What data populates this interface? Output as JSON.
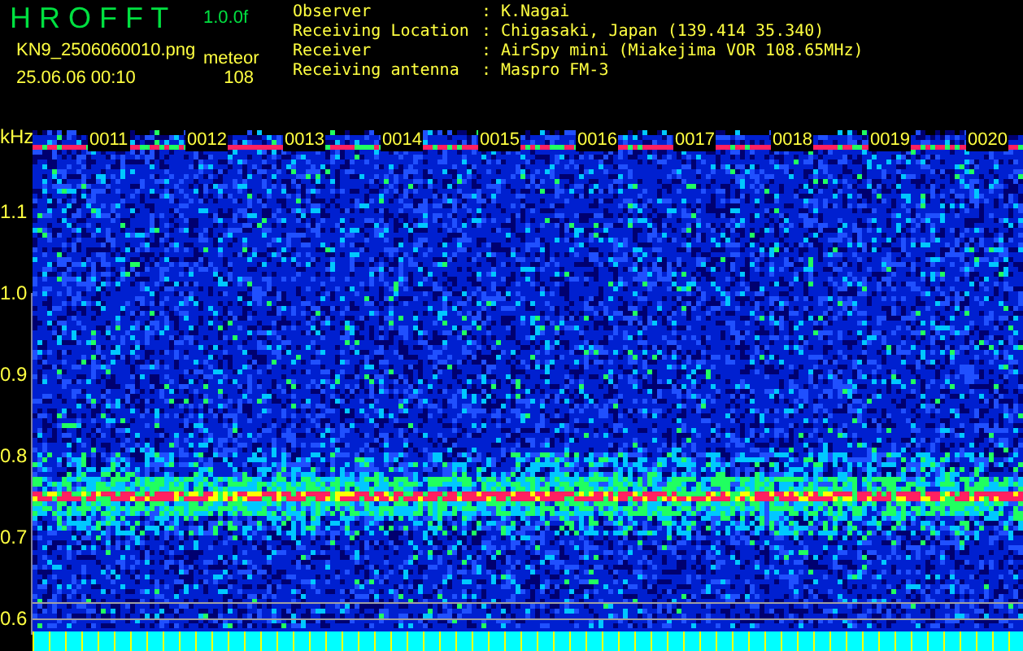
{
  "header": {
    "title": "H R O F F T",
    "version": "1.0.0f",
    "file": "KN9_2506060010.png",
    "meteor_label": "meteor",
    "datetime": "25.06.06 00:10",
    "meteor_count": "108"
  },
  "info": [
    {
      "label": "Observer",
      "colon": ":",
      "value": "K.Nagai"
    },
    {
      "label": "Receiving Location",
      "colon": ":",
      "value": "Chigasaki, Japan (139.414 35.340)"
    },
    {
      "label": "Receiver",
      "colon": ":",
      "value": "AirSpy mini (Miakejima VOR 108.65MHz)"
    },
    {
      "label": "Receiving antenna",
      "colon": ":",
      "value": "Maspro FM-3"
    }
  ],
  "spectrogram": {
    "unit": "kHz",
    "frequency_labels": [
      "1.1",
      "1.0",
      "0.9",
      "0.8",
      "0.7",
      "0.6"
    ],
    "time_labels": [
      "0011",
      "0012",
      "0013",
      "0014",
      "0015",
      "0016",
      "0017",
      "0018",
      "0019",
      "0020"
    ]
  }
}
